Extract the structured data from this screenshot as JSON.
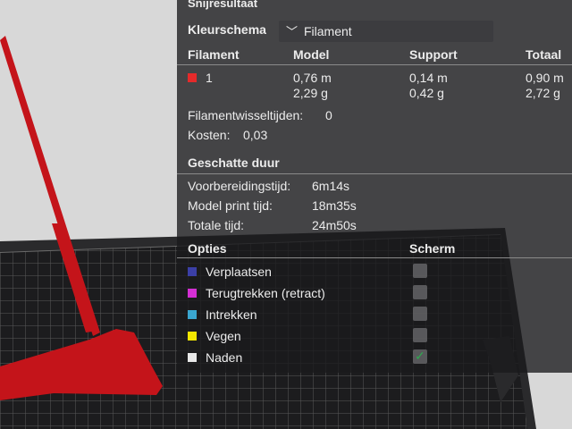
{
  "title": "Snijresultaat",
  "color_scheme": {
    "label": "Kleurschema",
    "value": "Filament",
    "chevron_icon": "chevron-down-icon"
  },
  "table": {
    "headers": [
      "Filament",
      "Model",
      "Support",
      "Totaal"
    ],
    "rows": [
      {
        "swatch_color": "#e52a2a",
        "id": "1",
        "model_len": "0,76 m",
        "model_wt": "2,29 g",
        "support_len": "0,14 m",
        "support_wt": "0,42 g",
        "total_len": "0,90 m",
        "total_wt": "2,72 g"
      }
    ]
  },
  "filament_changes": {
    "label": "Filamentwisseltijden:",
    "value": "0"
  },
  "cost": {
    "label": "Kosten:",
    "value": "0,03"
  },
  "duration": {
    "heading": "Geschatte duur",
    "rows": [
      {
        "label": "Voorbereidingstijd:",
        "value": "6m14s"
      },
      {
        "label": "Model print tijd:",
        "value": "18m35s"
      },
      {
        "label": "Totale tijd:",
        "value": "24m50s"
      }
    ]
  },
  "options": {
    "header": "Opties",
    "display_header": "Scherm",
    "items": [
      {
        "label": "Verplaatsen",
        "color": "#3b3fa6",
        "checked": false
      },
      {
        "label": "Terugtrekken (retract)",
        "color": "#d42fd4",
        "checked": false
      },
      {
        "label": "Intrekken",
        "color": "#3aa6d0",
        "checked": false
      },
      {
        "label": "Vegen",
        "color": "#f2e600",
        "checked": false
      },
      {
        "label": "Naden",
        "color": "#e8e8e8",
        "checked": true
      }
    ]
  },
  "colors": {
    "accent": "#2fa84f",
    "filament": "#c4141a"
  }
}
